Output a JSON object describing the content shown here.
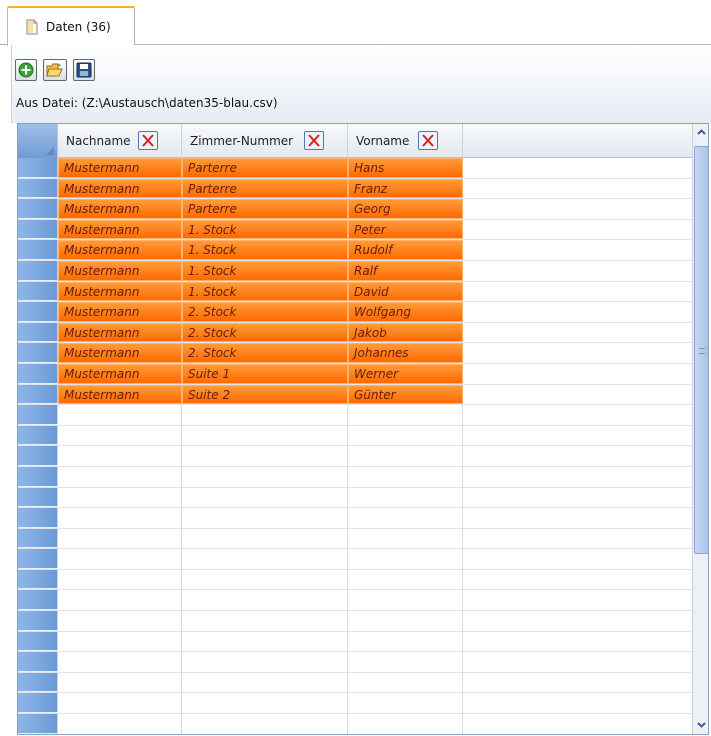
{
  "tab": {
    "label": "Daten (36)",
    "icon": "document-icon"
  },
  "toolbar": {
    "buttons": [
      {
        "name": "add-button",
        "icon": "plus-circle-icon"
      },
      {
        "name": "open-button",
        "icon": "folder-open-icon"
      },
      {
        "name": "save-button",
        "icon": "floppy-disk-icon"
      }
    ],
    "source_label": "Aus Datei: (Z:\\Austausch\\daten35-blau.csv)"
  },
  "grid": {
    "columns": [
      "Nachname",
      "Zimmer-Nummer",
      "Vorname"
    ],
    "rows": [
      [
        "Mustermann",
        "Parterre",
        "Hans"
      ],
      [
        "Mustermann",
        "Parterre",
        "Franz"
      ],
      [
        "Mustermann",
        "Parterre",
        "Georg"
      ],
      [
        "Mustermann",
        "1. Stock",
        "Peter"
      ],
      [
        "Mustermann",
        "1. Stock",
        "Rudolf"
      ],
      [
        "Mustermann",
        "1. Stock",
        "Ralf"
      ],
      [
        "Mustermann",
        "1. Stock",
        "David"
      ],
      [
        "Mustermann",
        "2. Stock",
        "Wolfgang"
      ],
      [
        "Mustermann",
        "2. Stock",
        "Jakob"
      ],
      [
        "Mustermann",
        "2. Stock",
        "Johannes"
      ],
      [
        "Mustermann",
        "Suite 1",
        "Werner"
      ],
      [
        "Mustermann",
        "Suite 2",
        "Günter"
      ]
    ],
    "empty_rows": 16
  },
  "colors": {
    "accent_tab": "#f3b21f",
    "cell_fill": "#ff7a10",
    "row_handle": "#7aa7de"
  }
}
